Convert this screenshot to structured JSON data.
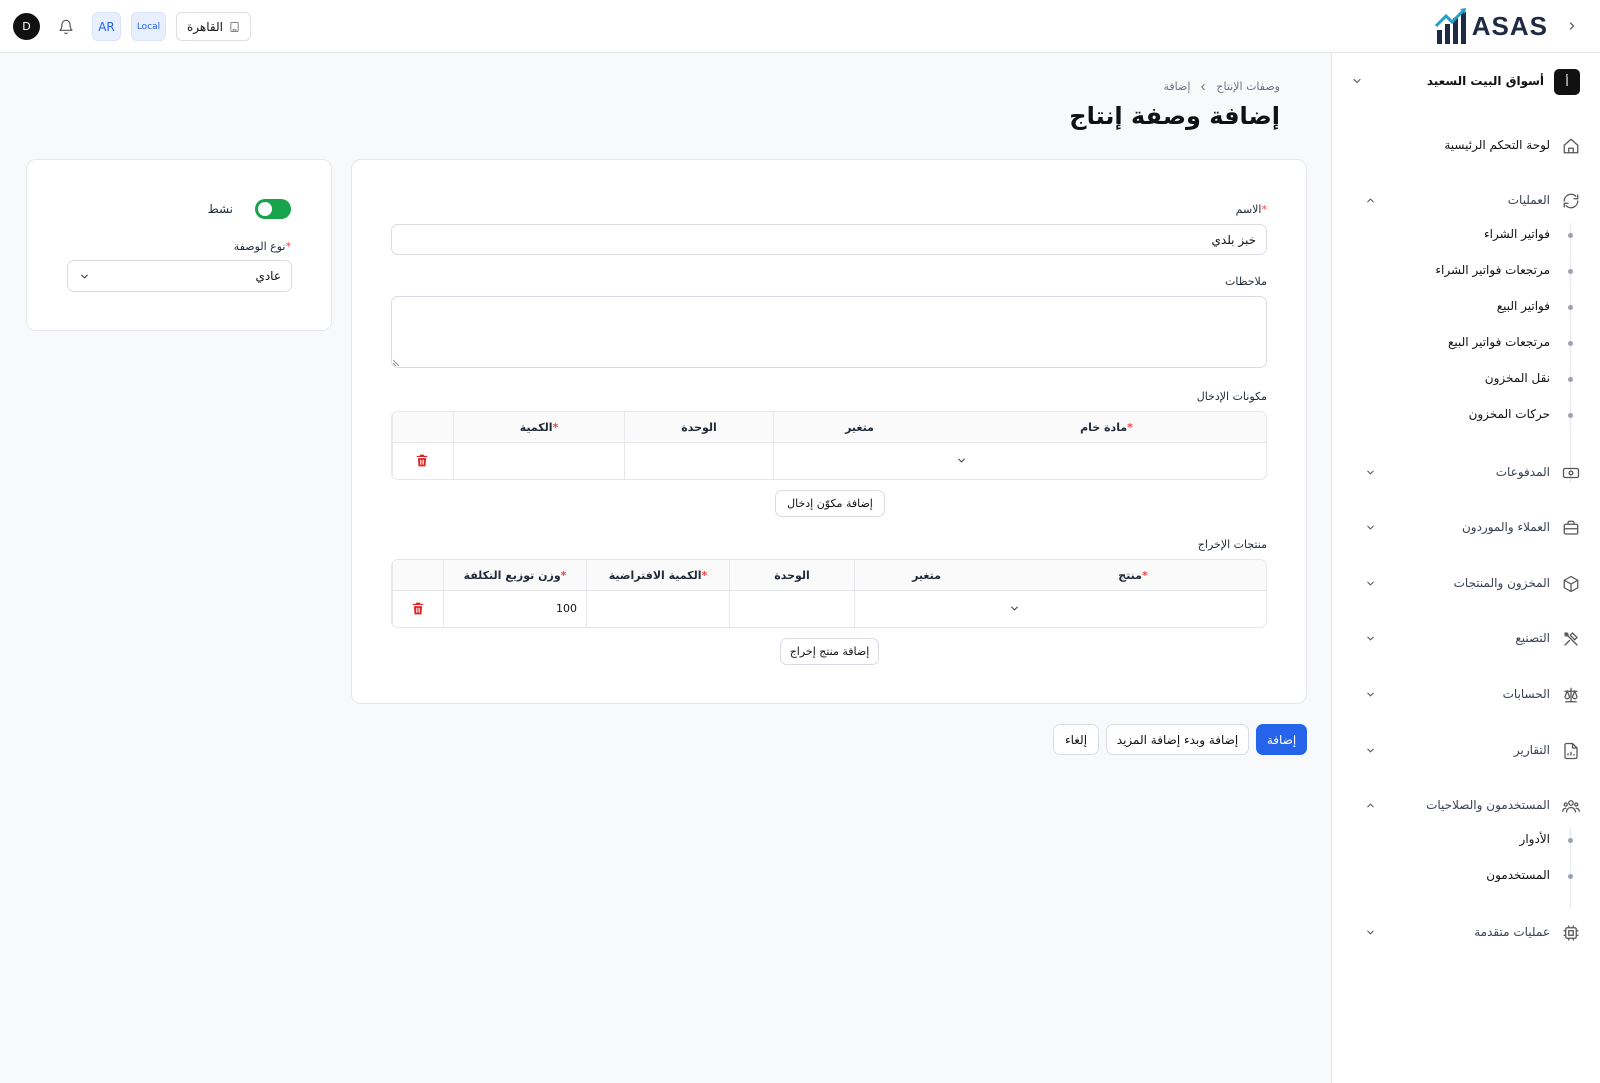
{
  "topbar": {
    "user_initial": "D",
    "language": "AR",
    "environment": "Local",
    "branch": "القاهرة",
    "brand": "ASAS"
  },
  "sidebar": {
    "company": {
      "initial": "أ",
      "name": "أسواق البيت السعيد"
    },
    "dashboard": "لوحة التحكم الرئيسية",
    "operations": {
      "label": "العمليات",
      "items": [
        "فواتير الشراء",
        "مرتجعات فواتير الشراء",
        "فواتير البيع",
        "مرتجعات فواتير البيع",
        "نقل المخزون",
        "حركات المخزون"
      ]
    },
    "payments": "المدفوعات",
    "customers_suppliers": "العملاء والموردون",
    "inventory_products": "المخزون والمنتجات",
    "manufacturing": "التصنيع",
    "accounts": "الحسابات",
    "reports": "التقارير",
    "users_permissions": {
      "label": "المستخدمون والصلاحيات",
      "items": [
        "الأدوار",
        "المستخدمون"
      ]
    },
    "advanced": "عمليات متقدمة"
  },
  "breadcrumb": {
    "parent": "وصفات الإنتاج",
    "current": "إضافة"
  },
  "page_title": "إضافة وصفة إنتاج",
  "form": {
    "name_label": "الاسم",
    "name_value": "خبز بلدي",
    "notes_label": "ملاحظات",
    "inputs_section": {
      "title": "مكونات الإدخال",
      "columns": {
        "raw_material": "مادة خام",
        "variant": "متغير",
        "unit": "الوحدة",
        "quantity": "الكمية"
      },
      "add_button": "إضافة مكوّن إدخال"
    },
    "outputs_section": {
      "title": "منتجات الإخراج",
      "columns": {
        "product": "منتج",
        "variant": "متغير",
        "unit": "الوحدة",
        "default_quantity": "الكمية الافتراضية",
        "cost_weight": "وزن توزيع التكلفة"
      },
      "row": {
        "cost_weight": "100"
      },
      "add_button": "إضافة منتج إخراج"
    }
  },
  "side": {
    "active_label": "نشط",
    "active": true,
    "recipe_type_label": "نوع الوصفة",
    "recipe_type_value": "عادي"
  },
  "actions": {
    "add": "إضافة",
    "add_and_new": "إضافة وبدء إضافة المزيد",
    "cancel": "إلغاء"
  },
  "colors": {
    "primary": "#2563eb",
    "toggle_on": "#16a34a",
    "danger": "#dc2626"
  }
}
